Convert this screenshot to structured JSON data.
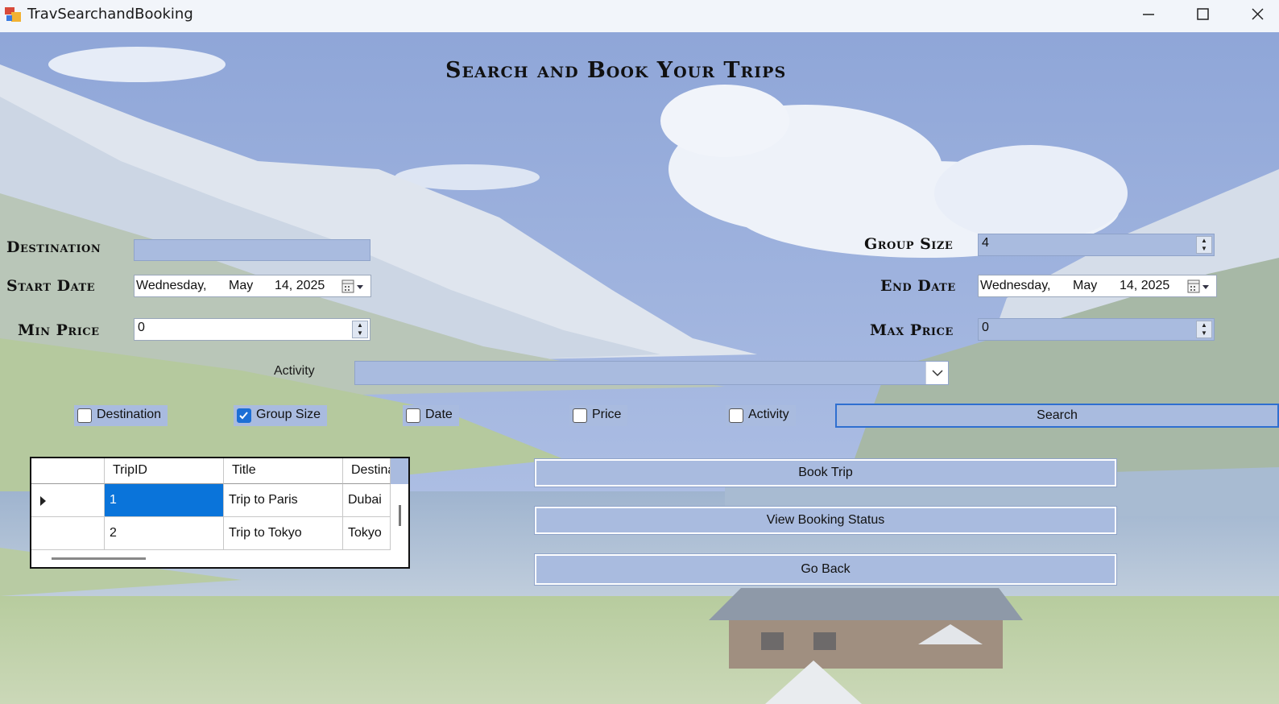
{
  "window": {
    "title": "TravSearchandBooking",
    "icon": "app-form-icon",
    "controls": [
      "minimize-icon",
      "maximize-icon",
      "close-icon"
    ]
  },
  "heading": "Search and Book Your Trips",
  "form": {
    "destination": {
      "label": "Destination",
      "value": ""
    },
    "start_date": {
      "label": "Start Date",
      "weekday": "Wednesday,",
      "month": "May",
      "day_year": "14, 2025"
    },
    "min_price": {
      "label": "Min Price",
      "value": "0"
    },
    "group_size": {
      "label": "Group Size",
      "value": "4"
    },
    "end_date": {
      "label": "End Date",
      "weekday": "Wednesday,",
      "month": "May",
      "day_year": "14, 2025"
    },
    "max_price": {
      "label": "Max Price",
      "value": "0"
    },
    "activity": {
      "label": "Activity",
      "value": ""
    }
  },
  "filters": [
    {
      "label": "Destination",
      "checked": false
    },
    {
      "label": "Group Size",
      "checked": true
    },
    {
      "label": "Date",
      "checked": false
    },
    {
      "label": "Price",
      "checked": false
    },
    {
      "label": "Activity",
      "checked": false
    }
  ],
  "buttons": {
    "search": "Search",
    "book_trip": "Book Trip",
    "view_booking_status": "View Booking Status",
    "go_back": "Go Back"
  },
  "grid": {
    "columns": [
      "TripID",
      "Title",
      "Destina"
    ],
    "rows": [
      {
        "trip_id": "1",
        "title": "Trip to Paris",
        "destination": "Dubai",
        "selected": true
      },
      {
        "trip_id": "2",
        "title": "Trip to Tokyo",
        "destination": "Tokyo",
        "selected": false
      }
    ]
  },
  "colors": {
    "control_fill": "#a9bbdf",
    "selection": "#0a74da",
    "search_border": "#2f6fd0",
    "checkbox_checked": "#1c6fd6"
  }
}
